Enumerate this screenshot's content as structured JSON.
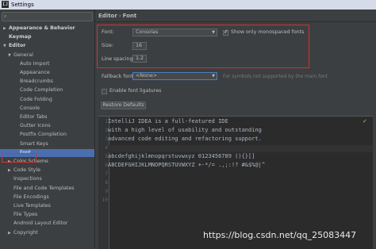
{
  "window": {
    "title": "Settings",
    "app_icon": "IJ"
  },
  "sidebar": {
    "search_icon": "magnifier-icon",
    "items": [
      {
        "label": "Appearance & Behavior",
        "bold": true,
        "arrow": "▶"
      },
      {
        "label": "Keymap",
        "bold": true,
        "arrow": ""
      },
      {
        "label": "Editor",
        "bold": true,
        "arrow": "▼"
      },
      {
        "label": "General",
        "bold": false,
        "arrow": "▼"
      },
      {
        "label": "Auto Import",
        "bold": false,
        "arrow": ""
      },
      {
        "label": "Appearance",
        "bold": false,
        "arrow": ""
      },
      {
        "label": "Breadcrumbs",
        "bold": false,
        "arrow": ""
      },
      {
        "label": "Code Completion",
        "bold": false,
        "arrow": ""
      },
      {
        "label": "Code Folding",
        "bold": false,
        "arrow": ""
      },
      {
        "label": "Console",
        "bold": false,
        "arrow": ""
      },
      {
        "label": "Editor Tabs",
        "bold": false,
        "arrow": ""
      },
      {
        "label": "Gutter Icons",
        "bold": false,
        "arrow": ""
      },
      {
        "label": "Postfix Completion",
        "bold": false,
        "arrow": ""
      },
      {
        "label": "Smart Keys",
        "bold": false,
        "arrow": ""
      },
      {
        "label": "Font",
        "bold": false,
        "arrow": "",
        "selected": true
      },
      {
        "label": "Color Scheme",
        "bold": false,
        "arrow": "▶"
      },
      {
        "label": "Code Style",
        "bold": false,
        "arrow": "▶"
      },
      {
        "label": "Inspections",
        "bold": false,
        "arrow": ""
      },
      {
        "label": "File and Code Templates",
        "bold": false,
        "arrow": ""
      },
      {
        "label": "File Encodings",
        "bold": false,
        "arrow": ""
      },
      {
        "label": "Live Templates",
        "bold": false,
        "arrow": ""
      },
      {
        "label": "File Types",
        "bold": false,
        "arrow": ""
      },
      {
        "label": "Android Layout Editor",
        "bold": false,
        "arrow": ""
      },
      {
        "label": "Copyright",
        "bold": false,
        "arrow": "▶"
      }
    ]
  },
  "breadcrumb": {
    "parent": "Editor",
    "separator": "›",
    "current": "Font"
  },
  "font_settings": {
    "font_label": "Font:",
    "font_value": "Consolas",
    "monospaced_label": "Show only monospaced fonts",
    "monospaced_checked": true,
    "size_label": "Size:",
    "size_value": "16",
    "line_spacing_label": "Line spacing:",
    "line_spacing_value": "1.2",
    "fallback_label": "Fallback font:",
    "fallback_value": "<None>",
    "fallback_hint": "For symbols not supported by the main font",
    "ligatures_label": "Enable font ligatures",
    "ligatures_checked": false,
    "restore_button": "Restore Defaults"
  },
  "editor_preview": {
    "line_numbers": [
      "1",
      "2",
      "3",
      "4",
      "5",
      "6",
      "7",
      "8",
      "9",
      "10"
    ],
    "lines": [
      "IntelliJ IDEA is a full-featured IDE",
      "with a high level of usability and outstanding",
      "advanced code editing and refactoring support.",
      "",
      "abcdefghijklmnopqrstuvwxyz 0123456789 (){}[]",
      "ABCDEFGHIJKLMNOPQRSTUVWXYZ +-*/= .,;:!? #&$%@|^",
      "",
      "",
      "",
      ""
    ]
  },
  "watermark": "https://blog.csdn.net/qq_25083447",
  "colors": {
    "selection": "#4b6eaf",
    "highlight_box": "#d23030",
    "background": "#3c3f41",
    "editor_bg": "#2b2b2b"
  }
}
